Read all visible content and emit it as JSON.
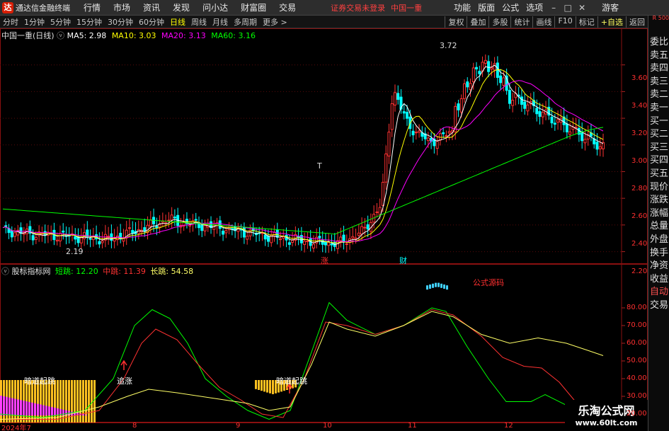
{
  "titlebar": {
    "app_title": "通达信金融终端",
    "menu": [
      "行情",
      "市场",
      "资讯",
      "发现",
      "问小达",
      "财富圈",
      "交易"
    ],
    "status": "证券交易未登录",
    "stock": "中国一重",
    "right_menu": [
      "功能",
      "版面",
      "公式",
      "选项"
    ],
    "guest": "游客"
  },
  "toolbar": {
    "periods": [
      "分时",
      "1分钟",
      "5分钟",
      "15分钟",
      "30分钟",
      "60分钟",
      "日线",
      "周线",
      "月线",
      "多周期",
      "更多 >"
    ],
    "active_period": "日线",
    "right_tools": [
      "复权",
      "叠加",
      "多股",
      "统计",
      "画线",
      "F10",
      "标记",
      "+自选",
      "返回"
    ]
  },
  "right_panel": {
    "tag": "R 500",
    "items": [
      "委比",
      "卖五",
      "卖四",
      "卖三",
      "卖二",
      "卖一",
      "买一",
      "买二",
      "买三",
      "买四",
      "买五",
      "现价",
      "涨跌",
      "涨幅",
      "总量",
      "外盘",
      "换手",
      "净资",
      "收益",
      "自动",
      "交易"
    ]
  },
  "main_chart": {
    "title": "中国一重(日线)",
    "ma5": "MA5: 2.98",
    "ma10": "MA10: 3.03",
    "ma20": "MA20: 3.13",
    "ma60": "MA60: 3.16",
    "y_ticks": [
      "3.60",
      "3.40",
      "3.20",
      "3.00",
      "2.80",
      "2.60",
      "2.40",
      "2.20"
    ],
    "high_label": "3.72",
    "low_label": "2.19",
    "t_label": "T",
    "zhang_label": "涨",
    "cai_label": "财"
  },
  "indicator": {
    "name": "股标指标网",
    "short": "短跳: 12.20",
    "mid": "中跳: 11.39",
    "long": "长跳: 54.58",
    "y_ticks": [
      "80.00",
      "70.00",
      "60.00",
      "50.00",
      "40.00",
      "30.00",
      "20.00"
    ],
    "label_zhui": "追涨",
    "label_bd1": "暗道起跳",
    "label_bd2": "暗道起跳",
    "label_formula": "公式源码"
  },
  "x_axis": [
    "2024年7",
    "8",
    "9",
    "10",
    "11",
    "12"
  ],
  "watermark": {
    "line1": "乐淘公式网",
    "line2": "www.60lt.com"
  },
  "colors": {
    "up": "#ff3232",
    "down": "#00ffff",
    "ma5": "#ffffff",
    "ma10": "#ffff00",
    "ma20": "#ff00ff",
    "ma60": "#00ff00",
    "short": "#00ff00",
    "mid": "#ff3232",
    "long": "#ffff66"
  },
  "chart_data": {
    "type": "line",
    "series": [
      {
        "name": "MA5",
        "value": 2.98
      },
      {
        "name": "MA10",
        "value": 3.03
      },
      {
        "name": "MA20",
        "value": 3.13
      },
      {
        "name": "MA60",
        "value": 3.16
      }
    ],
    "ylim": [
      2.15,
      3.8
    ],
    "indicator_series": [
      {
        "name": "短跳",
        "value": 12.2
      },
      {
        "name": "中跳",
        "value": 11.39
      },
      {
        "name": "长跳",
        "value": 54.58
      }
    ],
    "indicator_ylim": [
      15,
      85
    ]
  }
}
